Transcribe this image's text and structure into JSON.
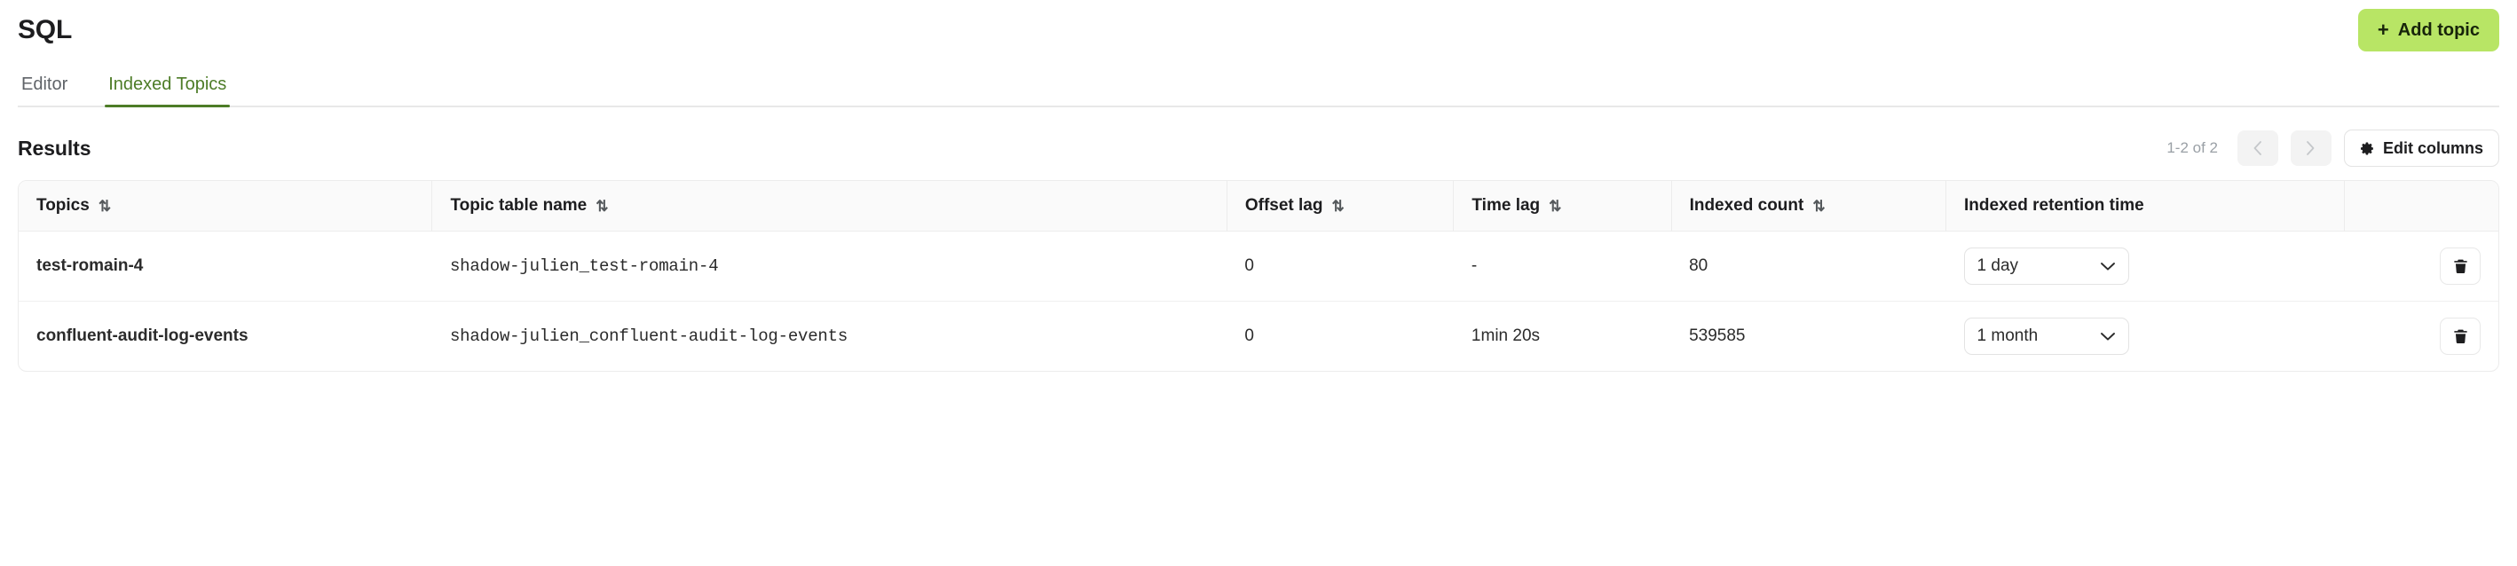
{
  "header": {
    "title": "SQL",
    "add_topic_label": "Add topic",
    "add_topic_icon": "plus-icon",
    "accent_green": "#b8e565",
    "accent_text": "#17240a"
  },
  "tabs": [
    {
      "label": "Editor",
      "active": false
    },
    {
      "label": "Indexed Topics",
      "active": true
    }
  ],
  "tab_active_color": "#4d7c27",
  "results": {
    "title": "Results",
    "pagination": "1-2 of 2",
    "prev_icon": "chevron-left-icon",
    "next_icon": "chevron-right-icon",
    "edit_columns_label": "Edit columns",
    "edit_columns_icon": "gear-icon"
  },
  "table": {
    "columns": [
      {
        "label": "Topics",
        "sortable": true
      },
      {
        "label": "Topic table name",
        "sortable": true
      },
      {
        "label": "Offset lag",
        "sortable": true
      },
      {
        "label": "Time lag",
        "sortable": true
      },
      {
        "label": "Indexed count",
        "sortable": true
      },
      {
        "label": "Indexed retention time",
        "sortable": false
      },
      {
        "label": "",
        "sortable": false
      }
    ],
    "sort_icon": "sort-ascending-descending-icon",
    "rows": [
      {
        "topic": "test-romain-4",
        "topic_table_name": "shadow-julien_test-romain-4",
        "offset_lag": "0",
        "time_lag": "-",
        "indexed_count": "80",
        "retention": "1 day",
        "retention_chevron": "chevron-down-icon",
        "delete_icon": "trash-icon"
      },
      {
        "topic": "confluent-audit-log-events",
        "topic_table_name": "shadow-julien_confluent-audit-log-events",
        "offset_lag": "0",
        "time_lag": "1min 20s",
        "indexed_count": "539585",
        "retention": "1 month",
        "retention_chevron": "chevron-down-icon",
        "delete_icon": "trash-icon"
      }
    ]
  }
}
